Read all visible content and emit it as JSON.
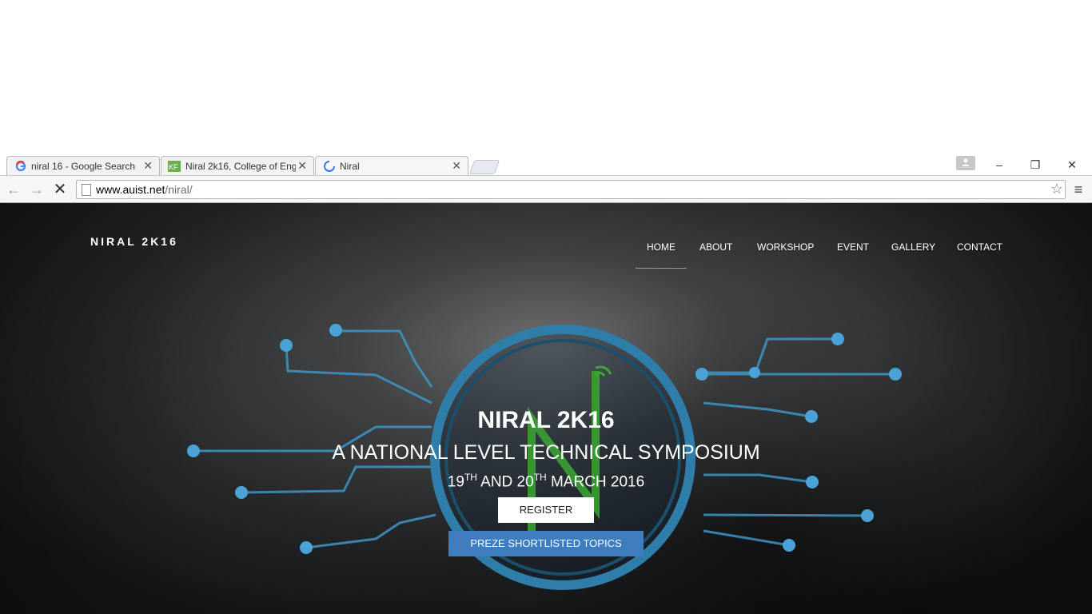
{
  "browser": {
    "tabs": [
      {
        "title": "niral 16 - Google Search",
        "favicon": "google-icon"
      },
      {
        "title": "Niral 2k16, College of Eng",
        "favicon": "kf-site-icon"
      },
      {
        "title": "Niral",
        "favicon": "loading-spinner-icon"
      }
    ],
    "url_host": "www.auist.net",
    "url_path": "/niral/",
    "window_controls": {
      "minimize": "‒",
      "restore": "❐",
      "close": "✕"
    }
  },
  "site": {
    "brand": "NIRAL 2K16",
    "nav": [
      "HOME",
      "ABOUT",
      "WORKSHOP",
      "EVENT",
      "GALLERY",
      "CONTACT"
    ],
    "active_nav": "HOME",
    "hero": {
      "title": "NIRAL 2K16",
      "subtitle": "A NATIONAL LEVEL TECHNICAL SYMPOSIUM",
      "date_day1": "19",
      "date_sup1": "TH",
      "date_and": " AND 20",
      "date_sup2": "TH",
      "date_rest": " MARCH 2016",
      "register_label": "REGISTER",
      "topics_label": "PREZE SHORTLISTED TOPICS"
    }
  },
  "colors": {
    "accent_blue": "#3f7dbf",
    "circuit_blue": "#4aa3d6",
    "logo_green": "#3aa832"
  }
}
